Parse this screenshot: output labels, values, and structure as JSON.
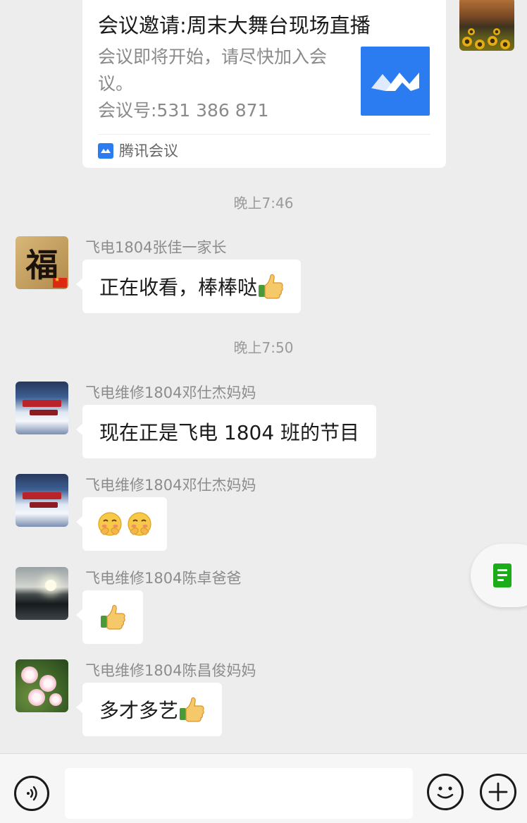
{
  "meeting_card": {
    "title": "会议邀请:周末大舞台现场直播",
    "description": "会议即将开始，请尽快加入会议。",
    "meeting_number": "会议号:531 386 871",
    "source_label": "腾讯会议",
    "brand_color": "#2b7cf1"
  },
  "timestamps": [
    "晚上7:46",
    "晚上7:50"
  ],
  "messages": [
    {
      "sender": "飞电1804张佳一家长",
      "text": "正在收看，棒棒哒",
      "emoji": "thumbs-up"
    },
    {
      "sender": "飞电维修1804邓仕杰妈妈",
      "text": "现在正是飞电 1804 班的节目",
      "emoji": ""
    },
    {
      "sender": "飞电维修1804邓仕杰妈妈",
      "text": "",
      "emoji": "blushing-face x2"
    },
    {
      "sender": "飞电维修1804陈卓爸爸",
      "text": "",
      "emoji": "thumbs-up"
    },
    {
      "sender": "飞电维修1804陈昌俊妈妈",
      "text": "多才多艺",
      "emoji": "thumbs-up"
    }
  ],
  "input_bar": {
    "voice_icon": "voice-icon",
    "emoji_icon": "emoji-icon",
    "plus_icon": "plus-icon"
  },
  "floating_button_icon": "document-icon",
  "colors": {
    "background": "#ededed",
    "bubble": "#ffffff",
    "timestamp_text": "#9a9a9a",
    "sender_text": "#8c8c8c",
    "accent_green": "#1aad19"
  }
}
